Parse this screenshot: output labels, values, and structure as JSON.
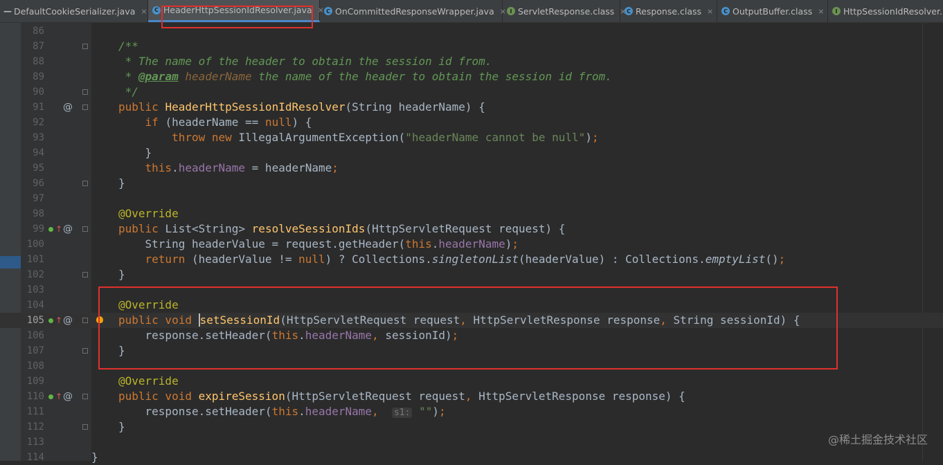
{
  "tabs": [
    {
      "name": "tab-defaultcookieserializer",
      "label": "DefaultCookieSerializer.java",
      "icon": "minus",
      "closable": true
    },
    {
      "name": "tab-headerhttpsessionidresolver",
      "label": "HeaderHttpSessionIdResolver.java",
      "icon": "class-c",
      "active": true,
      "closable": true
    },
    {
      "name": "tab-oncommittedresponsewrapper",
      "label": "OnCommittedResponseWrapper.java",
      "icon": "class-c",
      "closable": true
    },
    {
      "name": "tab-servletresponse",
      "label": "ServletResponse.class",
      "icon": "interface-i",
      "closable": true
    },
    {
      "name": "tab-response",
      "label": "Response.class",
      "icon": "class-c",
      "closable": true
    },
    {
      "name": "tab-outputbuffer",
      "label": "OutputBuffer.class",
      "icon": "class-c",
      "closable": true
    },
    {
      "name": "tab-httpsessionidresolver",
      "label": "HttpSessionIdResolver.",
      "icon": "interface-i",
      "closable": false
    }
  ],
  "tab_close_glyph": "×",
  "icons": {
    "class_letter": "C",
    "interface_letter": "I",
    "minus_glyph": "—",
    "override_arrow": "↑",
    "annotation_at": "@"
  },
  "editor": {
    "lines": [
      {
        "num": "86",
        "html": ""
      },
      {
        "num": "87",
        "html": "<span class=\"cm\">/**</span>"
      },
      {
        "num": "88",
        "html": "<span class=\"cm\"> * The name of the header to obtain the session id from.</span>"
      },
      {
        "num": "89",
        "html": "<span class=\"cm\"> * </span><span class=\"tg\">@param</span><span class=\"cm\"> <span style=\"color:#8a653b\">headerName</span> the name of the header to obtain the session id from.</span>"
      },
      {
        "num": "90",
        "html": "<span class=\"cm\"> */</span>"
      },
      {
        "num": "91",
        "html": "<span class=\"kw\">public </span><span class=\"fn\">HeaderHttpSessionIdResolver</span>(String headerName) {"
      },
      {
        "num": "92",
        "html": "    <span class=\"kw\">if </span>(headerName == <span class=\"kw\">null</span>) {"
      },
      {
        "num": "93",
        "html": "        <span class=\"kw\">throw new </span>IllegalArgumentException(<span class=\"st\">\"headerName cannot be null\"</span>)<span class=\"kw\">;</span>"
      },
      {
        "num": "94",
        "html": "    }"
      },
      {
        "num": "95",
        "html": "    <span class=\"kw\">this</span>.<span class=\"fd\">headerName</span> = headerName<span class=\"kw\">;</span>"
      },
      {
        "num": "96",
        "html": "}"
      },
      {
        "num": "97",
        "html": ""
      },
      {
        "num": "98",
        "html": "<span class=\"an\">@Override</span>"
      },
      {
        "num": "99",
        "html": "<span class=\"kw\">public </span>List&lt;String&gt; <span class=\"fn\">resolveSessionIds</span>(HttpServletRequest request) {"
      },
      {
        "num": "100",
        "html": "    String headerValue = request.getHeader(<span class=\"kw\">this</span>.<span class=\"fd\">headerName</span>)<span class=\"kw\">;</span>"
      },
      {
        "num": "101",
        "html": "    <span class=\"kw\">return </span>(headerValue != <span class=\"kw\">null</span>) ? Collections.<span class=\"it\">singletonList</span>(headerValue) : Collections.<span class=\"it\">emptyList</span>()<span class=\"kw\">;</span>"
      },
      {
        "num": "102",
        "html": "}"
      },
      {
        "num": "103",
        "html": ""
      },
      {
        "num": "104",
        "html": "<span class=\"an\">@Override</span>"
      },
      {
        "num": "105",
        "html": "<span class=\"kw\">public void </span><span class=\"caret\"></span><span class=\"fn\">setSessionId</span>(HttpServletRequest request<span class=\"kw\">, </span>HttpServletResponse response<span class=\"kw\">, </span>String sessionId) {",
        "current": true
      },
      {
        "num": "106",
        "html": "    response.setHeader(<span class=\"kw\">this</span>.<span class=\"fd\">headerName</span><span class=\"kw\">, </span>sessionId)<span class=\"kw\">;</span>"
      },
      {
        "num": "107",
        "html": "}"
      },
      {
        "num": "108",
        "html": ""
      },
      {
        "num": "109",
        "html": "<span class=\"an\">@Override</span>"
      },
      {
        "num": "110",
        "html": "<span class=\"kw\">public void </span><span class=\"fn\">expireSession</span>(HttpServletRequest request<span class=\"kw\">, </span>HttpServletResponse response) {"
      },
      {
        "num": "111",
        "html": "    response.setHeader(<span class=\"kw\">this</span>.<span class=\"fd\">headerName</span><span class=\"kw\">, </span> <span class=\"hint\">s1:</span> <span class=\"st\">\"\"</span>)<span class=\"kw\">;</span>"
      },
      {
        "num": "112",
        "html": "}"
      },
      {
        "num": "113",
        "html": ""
      },
      {
        "num": "114",
        "html": "}",
        "indent": -1
      }
    ]
  },
  "gutter": {
    "annotations": [
      {
        "line": "91",
        "at": true
      },
      {
        "line": "99",
        "at": true,
        "impl": true
      },
      {
        "line": "105",
        "at": true,
        "impl": true,
        "bulb": true
      },
      {
        "line": "110",
        "at": true,
        "impl": true
      }
    ],
    "folds": [
      "87",
      "90",
      "91",
      "96",
      "99",
      "102",
      "105",
      "107",
      "110",
      "112"
    ]
  },
  "watermark": "@稀土掘金技术社区",
  "colors": {
    "highlight_box": "#e0302c",
    "background": "#2b2b2b",
    "keyword": "#cc7832",
    "method": "#ffc66d",
    "field": "#9876aa",
    "string": "#6a8759",
    "comment": "#629755",
    "annotation": "#bbb529"
  }
}
